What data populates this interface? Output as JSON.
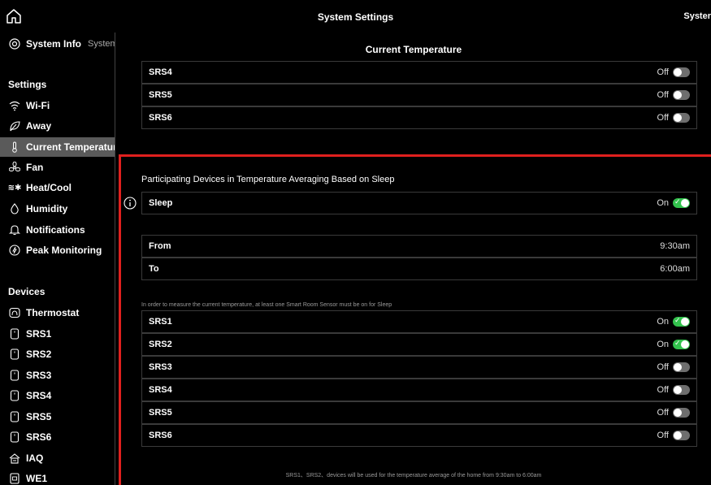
{
  "header": {
    "title": "System Settings",
    "right_label": "Syster"
  },
  "sidebar": {
    "system_info_label": "System Info",
    "system_sub": "System",
    "settings_heading": "Settings",
    "settings_items": [
      {
        "label": "Wi-Fi",
        "icon": "wifi-icon"
      },
      {
        "label": "Away",
        "icon": "leaf-icon"
      },
      {
        "label": "Current Temperature",
        "icon": "thermometer-icon",
        "active": true
      },
      {
        "label": "Fan",
        "icon": "fan-icon"
      },
      {
        "label": "Heat/Cool",
        "icon": "heat-cool-icon"
      },
      {
        "label": "Humidity",
        "icon": "droplet-icon"
      },
      {
        "label": "Notifications",
        "icon": "bell-icon"
      },
      {
        "label": "Peak Monitoring",
        "icon": "bolt-icon"
      }
    ],
    "devices_heading": "Devices",
    "device_items": [
      {
        "label": "Thermostat",
        "icon": "thermostat-icon"
      },
      {
        "label": "SRS1",
        "icon": "sensor-icon"
      },
      {
        "label": "SRS2",
        "icon": "sensor-icon"
      },
      {
        "label": "SRS3",
        "icon": "sensor-icon"
      },
      {
        "label": "SRS4",
        "icon": "sensor-icon"
      },
      {
        "label": "SRS5",
        "icon": "sensor-icon"
      },
      {
        "label": "SRS6",
        "icon": "sensor-icon"
      },
      {
        "label": "IAQ",
        "icon": "iaq-icon"
      },
      {
        "label": "WE1",
        "icon": "we1-icon"
      }
    ]
  },
  "main": {
    "section_title": "Current Temperature",
    "top_rows": [
      {
        "name": "SRS4",
        "state": "Off",
        "on": false
      },
      {
        "name": "SRS5",
        "state": "Off",
        "on": false
      },
      {
        "name": "SRS6",
        "state": "Off",
        "on": false
      }
    ],
    "participating_title": "Participating Devices in Temperature Averaging Based on Sleep",
    "sleep_row": {
      "name": "Sleep",
      "state": "On",
      "on": true
    },
    "schedule": [
      {
        "name": "From",
        "value": "9:30am"
      },
      {
        "name": "To",
        "value": "6:00am"
      }
    ],
    "note": "In order to measure the current temperature, at least one Smart Room Sensor must be on for Sleep",
    "sensor_rows": [
      {
        "name": "SRS1",
        "state": "On",
        "on": true
      },
      {
        "name": "SRS2",
        "state": "On",
        "on": true
      },
      {
        "name": "SRS3",
        "state": "Off",
        "on": false
      },
      {
        "name": "SRS4",
        "state": "Off",
        "on": false
      },
      {
        "name": "SRS5",
        "state": "Off",
        "on": false
      },
      {
        "name": "SRS6",
        "state": "Off",
        "on": false
      }
    ],
    "footnote": "SRS1、SRS2、devices will be used for the temperature average of the home from 9:30am to 6:00am"
  },
  "colors": {
    "highlight": "#e0201e",
    "toggle_on": "#33c24d",
    "active_item": "#5a5a5a"
  }
}
